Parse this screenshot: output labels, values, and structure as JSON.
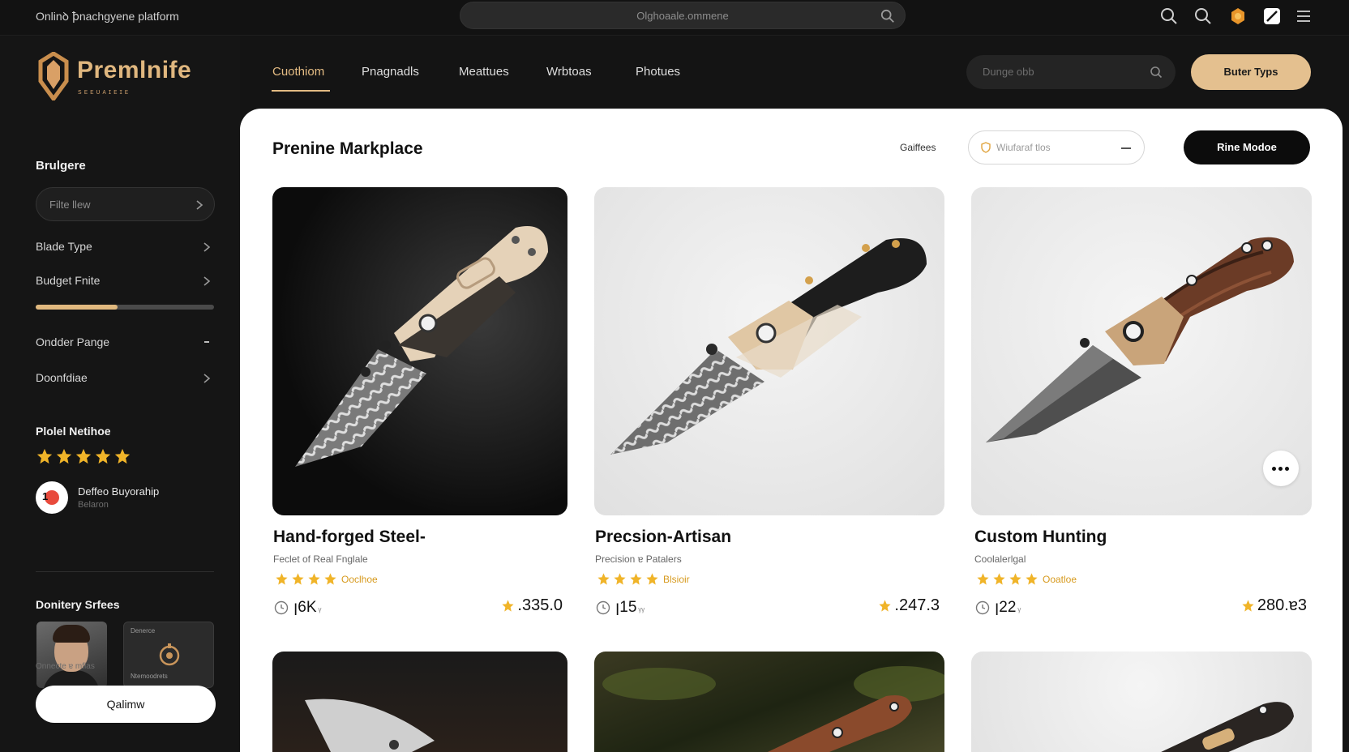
{
  "topbar": {
    "app_title": "Onlinꝺ ꝥnachgyene platform",
    "url_text": "Olghoaale.ommene",
    "icons": [
      "search-icon",
      "search-icon",
      "badge-icon",
      "edit-icon",
      "menu-icon"
    ]
  },
  "brand": {
    "name": "Premlnife",
    "tagline": "ꜱᴇᴇᴜᴀɪᴇɪᴇ",
    "accent": "#e0b77f"
  },
  "nav": {
    "tabs": [
      "Cuothiom",
      "Pnagnadls",
      "Meattues",
      "Wrbtoas",
      "Photues"
    ],
    "active_index": 0,
    "search_placeholder": "Dunge obb",
    "cta": "Buter Typs"
  },
  "sidebar": {
    "heading": "Brulgere",
    "filter_placeholder": "Filte llew",
    "rows": [
      {
        "label": "Blade Type",
        "control": "chevron"
      },
      {
        "label": "Budget Fnite",
        "control": "chevron"
      },
      {
        "label": "Ondder Pange",
        "control": "dash"
      },
      {
        "label": "Doonfdiae",
        "control": "chevron"
      }
    ],
    "budget_fill_fraction": 0.46,
    "rating_heading": "Plolel Netihoe",
    "rating_stars": 5,
    "seller": {
      "badge": "1",
      "name": "Deffeo Buyorahip",
      "sub": "Belaron"
    },
    "series_heading": "Donitery Srfees",
    "series_brand_top": "Denerce",
    "series_brand_bottom": "Ntemoodrets",
    "series_note": "Onnecte ɐ mflas",
    "button": "Qalimw"
  },
  "main": {
    "title": "Prenine Markplace",
    "filters_label": "Gaiffees",
    "material_placeholder": "Wiufaraf tlos",
    "mode_button": "Rine Modoe",
    "products": [
      {
        "title": "Hand-forged Steel-",
        "subtitle": "Feclet of Real Fnglale",
        "rating": 4,
        "rating_label": "Ooclhoe",
        "meta": "ꞁ6K",
        "meta_unit": "ᵧ",
        "price": ".335.0"
      },
      {
        "title": "Precsion-Artisan",
        "subtitle": "Precision ɐ Patalers",
        "rating": 4,
        "rating_label": "Blsioir",
        "meta": "ꞁ15",
        "meta_unit": "ᵧᵧ",
        "price": ".247.3"
      },
      {
        "title": "Custom Hunting",
        "subtitle": "Coolalerlgal",
        "rating": 4,
        "rating_label": "Ooatloe",
        "meta": "ꞁ22",
        "meta_unit": "ᵧ",
        "price": "280.ɐ3"
      }
    ]
  },
  "colors": {
    "gold": "#e3bb83",
    "star": "#f0b429",
    "panel": "#ffffff",
    "background": "#141414"
  }
}
